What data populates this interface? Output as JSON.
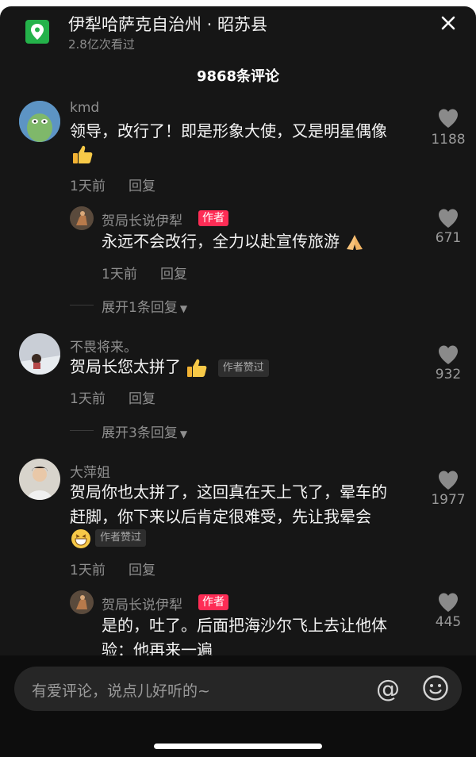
{
  "header": {
    "location_title": "伊犁哈萨克自治州 · 昭苏县",
    "views": "2.8亿次看过",
    "comment_count": "9868条评论"
  },
  "comments": [
    {
      "user": "kmd",
      "text_line1": "领导，改行了！即是形象大使，又是明星偶像",
      "time": "1天前",
      "reply_label": "回复",
      "likes": "1188",
      "reply": {
        "user": "贺局长说伊犁",
        "author_tag": "作者",
        "text": "永远不会改行，全力以赴宣传旅游",
        "time": "1天前",
        "reply_label": "回复",
        "likes": "671"
      },
      "expand": "展开1条回复"
    },
    {
      "user": "不畏将来。",
      "text": "贺局长您太拼了",
      "liked_tag": "作者赞过",
      "time": "1天前",
      "reply_label": "回复",
      "likes": "932",
      "expand": "展开3条回复"
    },
    {
      "user": "大萍姐",
      "text_line1": "贺局你也太拼了，这回真在天上飞了，晕车的",
      "text_line2": "赶脚，你下来以后肯定很难受，先让我晕会",
      "liked_tag": "作者赞过",
      "time": "1天前",
      "reply_label": "回复",
      "likes": "1977",
      "reply": {
        "user": "贺局长说伊犁",
        "author_tag": "作者",
        "text_line1": "是的，吐了。后面把海沙尔飞上去让他体",
        "text_line2": "验：他再来一遍",
        "likes": "445"
      }
    }
  ],
  "input": {
    "placeholder": "有爱评论，说点儿好听的~",
    "at_symbol": "@"
  },
  "colors": {
    "sheet_bg": "#161616",
    "author_tag": "#fe2c55",
    "location_icon": "#24b24a"
  }
}
